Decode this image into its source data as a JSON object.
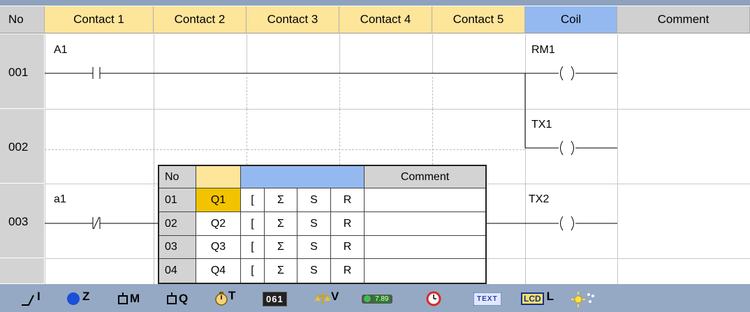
{
  "header": {
    "no": "No",
    "contacts": [
      "Contact 1",
      "Contact 2",
      "Contact 3",
      "Contact 4",
      "Contact 5"
    ],
    "coil": "Coil",
    "comment": "Comment"
  },
  "rows": [
    {
      "no": "001",
      "contact_label": "A1",
      "coil_label": "RM1"
    },
    {
      "no": "002",
      "contact_label": "",
      "coil_label": "TX1"
    },
    {
      "no": "003",
      "contact_label": "a1",
      "coil_label": "TX2"
    }
  ],
  "popup": {
    "header_no": "No",
    "header_comment": "Comment",
    "rows": [
      {
        "no": "01",
        "name": "Q1",
        "opts": [
          "[",
          "Ʃ",
          "S",
          "R"
        ],
        "selected": true
      },
      {
        "no": "02",
        "name": "Q2",
        "opts": [
          "[",
          "Ʃ",
          "S",
          "R"
        ],
        "selected": false
      },
      {
        "no": "03",
        "name": "Q3",
        "opts": [
          "[",
          "Ʃ",
          "S",
          "R"
        ],
        "selected": false
      },
      {
        "no": "04",
        "name": "Q4",
        "opts": [
          "[",
          "Ʃ",
          "S",
          "R"
        ],
        "selected": false
      }
    ]
  },
  "toolbar": {
    "items": [
      {
        "icon": "input-contact-icon",
        "letter": "I"
      },
      {
        "icon": "blue-circle-icon",
        "letter": "Z"
      },
      {
        "icon": "relay-m-icon",
        "letter": "M"
      },
      {
        "icon": "relay-q-icon",
        "letter": "Q"
      },
      {
        "icon": "timer-icon",
        "letter": "T"
      },
      {
        "icon": "counter-icon",
        "text": "061"
      },
      {
        "icon": "compare-icon",
        "letter": "V"
      },
      {
        "icon": "analog-display-icon",
        "text": "7.89"
      },
      {
        "icon": "clock-icon"
      },
      {
        "icon": "text-icon",
        "text": "TEXT"
      },
      {
        "icon": "lcd-icon",
        "text": "LCD",
        "letter": "L"
      },
      {
        "icon": "sun-icon"
      }
    ]
  },
  "colors": {
    "contact_header": "#fde59a",
    "coil_header": "#94b9f0",
    "gray_header": "#d0d0d0",
    "toolbar": "#95a9c4",
    "selected_cell": "#f2c300"
  }
}
